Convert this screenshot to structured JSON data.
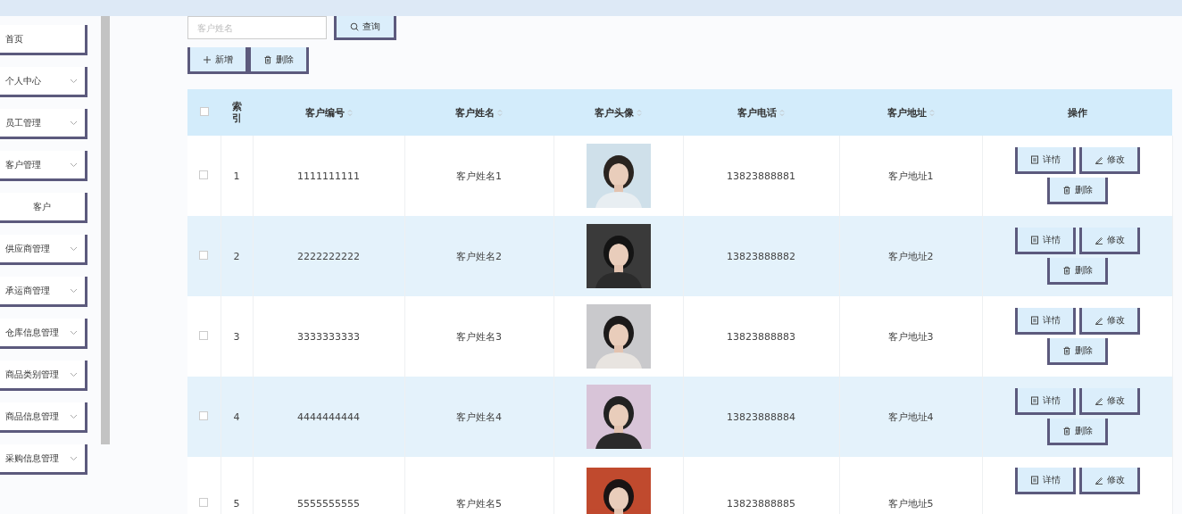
{
  "sidebar": {
    "items": [
      {
        "label": "首页",
        "kind": "item",
        "expandable": false
      },
      {
        "label": "个人中心",
        "kind": "item",
        "expandable": true
      },
      {
        "label": "员工管理",
        "kind": "item",
        "expandable": true
      },
      {
        "label": "客户管理",
        "kind": "item",
        "expandable": true
      },
      {
        "label": "客户",
        "kind": "subitem",
        "expandable": false
      },
      {
        "label": "供应商管理",
        "kind": "item",
        "expandable": true
      },
      {
        "label": "承运商管理",
        "kind": "item",
        "expandable": true
      },
      {
        "label": "仓库信息管理",
        "kind": "item",
        "expandable": true
      },
      {
        "label": "商品类别管理",
        "kind": "item",
        "expandable": true
      },
      {
        "label": "商品信息管理",
        "kind": "item",
        "expandable": true
      },
      {
        "label": "采购信息管理",
        "kind": "item",
        "expandable": true
      }
    ]
  },
  "search": {
    "placeholder": "客户姓名",
    "button": "查询"
  },
  "toolbar": [
    "新增",
    "删除"
  ],
  "table": {
    "header_checked": false,
    "columns": [
      {
        "label": "索引",
        "sortable": false
      },
      {
        "label": "客户编号",
        "sortable": true
      },
      {
        "label": "客户姓名",
        "sortable": true
      },
      {
        "label": "客户头像",
        "sortable": true
      },
      {
        "label": "客户电话",
        "sortable": true
      },
      {
        "label": "客户地址",
        "sortable": true
      },
      {
        "label": "操作",
        "sortable": false
      }
    ],
    "rows": [
      {
        "checked": false,
        "index": "1",
        "id": "1111111111",
        "name": "客户姓名1",
        "avatar": {
          "kind": "picture"
        },
        "phone": "13823888881",
        "address": "客户地址1",
        "actions": [
          "详情",
          "修改",
          "删除"
        ]
      },
      {
        "checked": false,
        "index": "2",
        "id": "2222222222",
        "name": "客户姓名2",
        "avatar": {
          "kind": "picture"
        },
        "phone": "13823888882",
        "address": "客户地址2",
        "actions": [
          "详情",
          "修改",
          "删除"
        ]
      },
      {
        "checked": false,
        "index": "3",
        "id": "3333333333",
        "name": "客户姓名3",
        "avatar": {
          "kind": "picture"
        },
        "phone": "13823888883",
        "address": "客户地址3",
        "actions": [
          "详情",
          "修改",
          "删除"
        ]
      },
      {
        "checked": false,
        "index": "4",
        "id": "4444444444",
        "name": "客户姓名4",
        "avatar": {
          "kind": "picture"
        },
        "phone": "13823888884",
        "address": "客户地址4",
        "actions": [
          "详情",
          "修改",
          "删除"
        ]
      },
      {
        "checked": false,
        "index": "5",
        "id": "5555555555",
        "name": "客户姓名5",
        "avatar": {
          "kind": "picture"
        },
        "phone": "13823888885",
        "address": "客户地址5",
        "actions": [
          "详情",
          "修改"
        ]
      }
    ]
  }
}
